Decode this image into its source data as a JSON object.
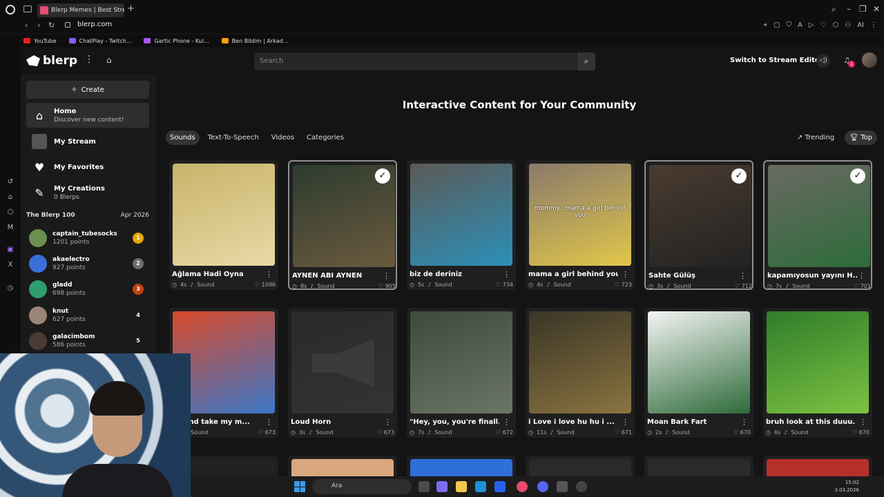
{
  "browser": {
    "tab_title": "Blerp Memes | Best Stream",
    "url": "blerp.com",
    "bookmarks": [
      {
        "label": "YouTube",
        "color": "#e62117"
      },
      {
        "label": "ChatPlay - Twitch...",
        "color": "#8a5cf6"
      },
      {
        "label": "Gartic Phone - Kul...",
        "color": "#a855f7"
      },
      {
        "label": "Ben Bildim | Arkad...",
        "color": "#f59e0b"
      }
    ],
    "toolbar_ai": "AI"
  },
  "header": {
    "logo_text": "blerp",
    "search_placeholder": "Search",
    "switch_label": "Switch to Stream Editor",
    "notifications_count": "1"
  },
  "sidebar": {
    "create_label": "Create",
    "items": [
      {
        "title": "Home",
        "subtitle": "Discover new content!"
      },
      {
        "title": "My Stream",
        "subtitle": ""
      },
      {
        "title": "My Favorites",
        "subtitle": ""
      },
      {
        "title": "My Creations",
        "subtitle": "0 Blerps"
      }
    ],
    "blerp100": {
      "label": "The Blerp 100",
      "date": "Apr 2026",
      "rankers": [
        {
          "name": "captain_tubesocks",
          "points": "1201 points",
          "rank": "1",
          "rank_color": "#e6a800",
          "avatar_color": "#6b8f4e"
        },
        {
          "name": "akaelectro",
          "points": "927 points",
          "rank": "2",
          "rank_color": "#6d6d6d",
          "avatar_color": "#3a6fd8"
        },
        {
          "name": "gladd",
          "points": "698 points",
          "rank": "3",
          "rank_color": "#c2410c",
          "avatar_color": "#2f9e6f"
        },
        {
          "name": "knut",
          "points": "627 points",
          "rank": "4",
          "rank_color": "#1a1a1a",
          "avatar_color": "#9a8577"
        },
        {
          "name": "galacimbom",
          "points": "586 points",
          "rank": "5",
          "rank_color": "#1a1a1a",
          "avatar_color": "#4a3b33"
        }
      ]
    }
  },
  "main": {
    "title": "Interactive Content for Your Community",
    "tabs": [
      "Sounds",
      "Text-To-Speech",
      "Videos",
      "Categories"
    ],
    "sorts": [
      "Trending",
      "Top"
    ],
    "sound_label": "Sound",
    "cards": [
      {
        "title": "Ağlama Hadi Oyna",
        "duration": "4s",
        "likes": "1096",
        "checked": false,
        "colors": [
          "#c8b46a",
          "#e9d9a6"
        ]
      },
      {
        "title": "AYNEN ABİ AYNEN",
        "duration": "8s",
        "likes": "905",
        "checked": true,
        "colors": [
          "#2d3b2f",
          "#6b5a3e"
        ]
      },
      {
        "title": "biz de deriniz",
        "duration": "5s",
        "likes": "734",
        "checked": false,
        "colors": [
          "#5b5a57",
          "#2c8fb8"
        ]
      },
      {
        "title": "mama a girl behind you",
        "duration": "4s",
        "likes": "723",
        "checked": false,
        "colors": [
          "#8a7a6a",
          "#e1c64a"
        ],
        "overlay": "mommy.. mama a girl behind you"
      },
      {
        "title": "Sahte Gülüş",
        "duration": "3s",
        "likes": "712",
        "checked": true,
        "colors": [
          "#4a3b30",
          "#222"
        ]
      },
      {
        "title": "kapamıyosun yayını H...",
        "duration": "7s",
        "likes": "701",
        "checked": true,
        "colors": [
          "#6a6a62",
          "#2d6b3a"
        ]
      },
      {
        "title": "up and take my m...",
        "duration": "",
        "likes": "673",
        "checked": false,
        "colors": [
          "#d8492a",
          "#3b78c8"
        ]
      },
      {
        "title": "Loud Horn",
        "duration": "3s",
        "likes": "673",
        "checked": false,
        "colors": [
          "#2a2a2a",
          "#333"
        ]
      },
      {
        "title": "\"Hey, you, you're finall...",
        "duration": "7s",
        "likes": "672",
        "checked": false,
        "colors": [
          "#3f4a3c",
          "#6b7565"
        ]
      },
      {
        "title": "i Love i love hu hu i ...",
        "duration": "11s",
        "likes": "671",
        "checked": false,
        "colors": [
          "#3a3526",
          "#8a7440"
        ]
      },
      {
        "title": "Moan Bark Fart",
        "duration": "2s",
        "likes": "670",
        "checked": false,
        "colors": [
          "#f4f4f4",
          "#2e6b3a"
        ]
      },
      {
        "title": "bruh look at this duuu...",
        "duration": "6s",
        "likes": "670",
        "checked": false,
        "colors": [
          "#2f7d2a",
          "#7cc242"
        ]
      }
    ]
  },
  "taskbar": {
    "search_label": "Ara",
    "time": "15:02",
    "date": "3.03.2026"
  }
}
